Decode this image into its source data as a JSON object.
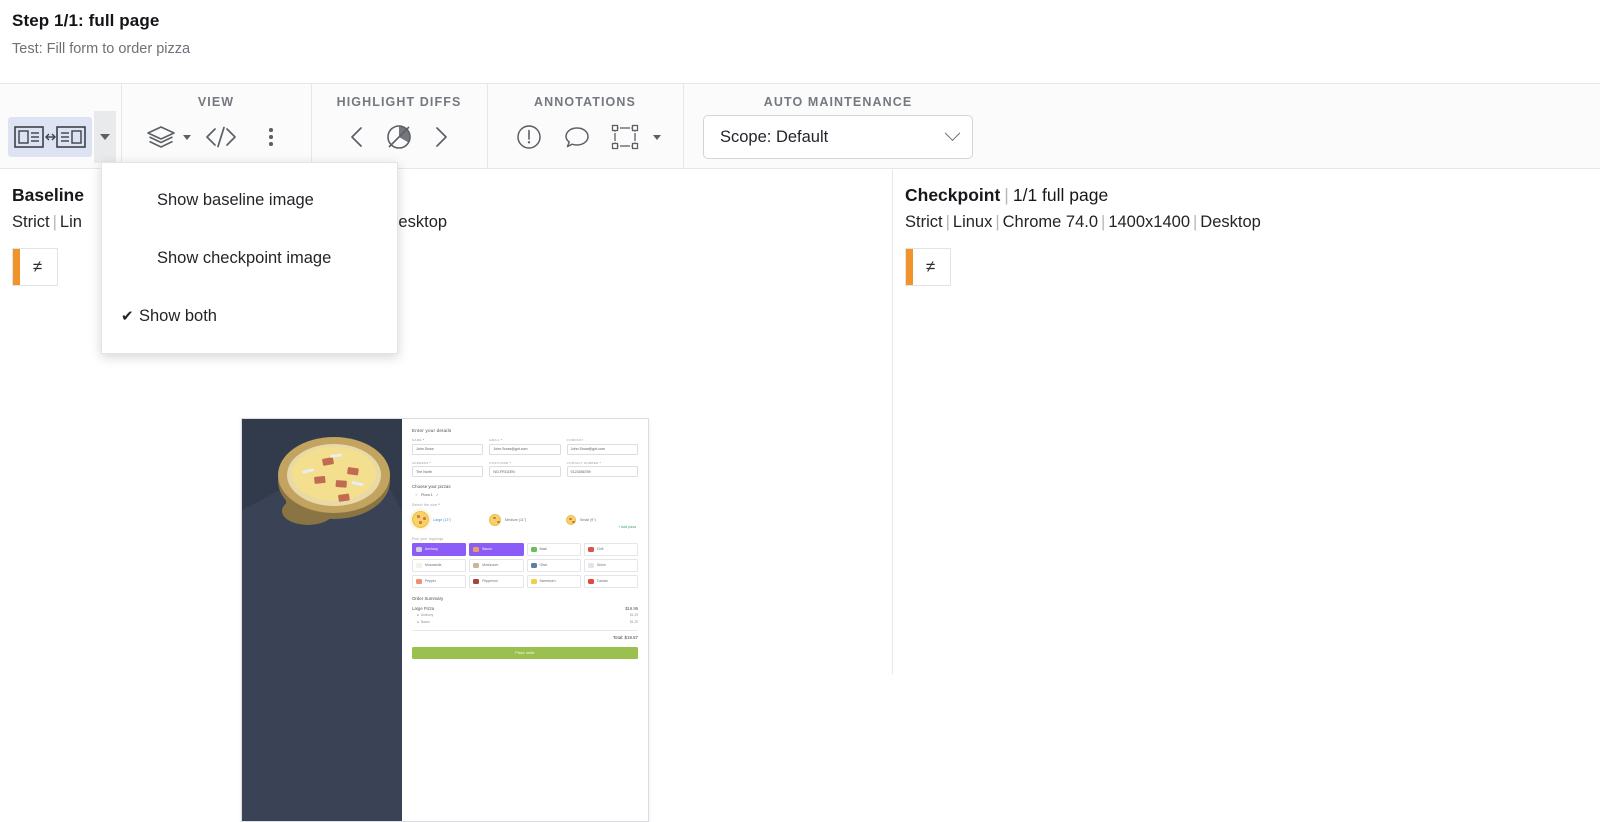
{
  "header": {
    "step_title": "Step 1/1: full page",
    "test_name": "Test: Fill form to order pizza"
  },
  "toolbar": {
    "groups": {
      "view_label": "VIEW",
      "highlight_label": "HIGHLIGHT DIFFS",
      "annotations_label": "ANNOTATIONS",
      "auto_maintenance_label": "AUTO MAINTENANCE"
    },
    "scope_select": "Scope: Default",
    "icons": {
      "layout_toggle": "side-by-side-layout-icon",
      "layers": "layers-icon",
      "code": "code-icon",
      "more": "more-vertical-icon",
      "prev_diff": "chevron-left-icon",
      "diff_target": "diff-circle-icon",
      "next_diff": "chevron-right-icon",
      "issue": "exclamation-circle-icon",
      "comment": "comment-bubble-icon",
      "region": "region-select-icon"
    }
  },
  "menu": {
    "items": [
      {
        "label": "Show baseline image",
        "checked": false
      },
      {
        "label": "Show checkpoint image",
        "checked": false
      },
      {
        "label": "Show both",
        "checked": true
      }
    ],
    "check_glyph": "✔"
  },
  "panels": {
    "baseline": {
      "title": "Baseline",
      "subtitle": "",
      "meta": [
        "Strict",
        "Lin",
        "Desktop"
      ],
      "meta_occluded": true,
      "diff_badge": "≠"
    },
    "checkpoint": {
      "title": "Checkpoint",
      "subtitle": "1/1 full page",
      "meta": [
        "Strict",
        "Linux",
        "Chrome 74.0",
        "1400x1400",
        "Desktop"
      ],
      "diff_badge": "≠"
    }
  },
  "screenshot": {
    "form_heading": "Enter your details",
    "fields_row1": [
      {
        "label": "NAME",
        "required": true,
        "value": "John Snow"
      },
      {
        "label": "EMAIL",
        "required": true,
        "value": "John.Snow@got.com"
      },
      {
        "label": "COMPANY",
        "required": false,
        "value": "John.Snow@got.com"
      }
    ],
    "fields_row2": [
      {
        "label": "ADDRESS",
        "required": true,
        "value": "The North"
      },
      {
        "label": "POSTCODE",
        "required": true,
        "value": "NO-FROZEN"
      },
      {
        "label": "CONTACT NUMBER",
        "required": true,
        "value": "0123456789"
      }
    ],
    "choose_heading": "Choose your pizzas",
    "add_pizza": "+ Add pizza",
    "pizza_tab": "Pizza 1",
    "size_heading": "Select the size",
    "sizes": [
      {
        "label": "Large (13\")",
        "selected": true
      },
      {
        "label": "Medium (11\")",
        "selected": false
      },
      {
        "label": "Small (9\")",
        "selected": false
      }
    ],
    "toppings_heading": "Pick your toppings",
    "toppings": [
      {
        "label": "Anchovy",
        "selected": true,
        "color": "#cfd3d8"
      },
      {
        "label": "Bacon",
        "selected": true,
        "color": "#e8a05a"
      },
      {
        "label": "Basil",
        "selected": false,
        "color": "#6bbf59"
      },
      {
        "label": "Chili",
        "selected": false,
        "color": "#d9534f"
      },
      {
        "label": "Mozzarella",
        "selected": false,
        "color": "#f3f1e8"
      },
      {
        "label": "Mushroom",
        "selected": false,
        "color": "#c8b79a"
      },
      {
        "label": "Olive",
        "selected": false,
        "color": "#5b7fa6"
      },
      {
        "label": "Onion",
        "selected": false,
        "color": "#e6e2ea"
      },
      {
        "label": "Pepper",
        "selected": false,
        "color": "#ef8f6e"
      },
      {
        "label": "Pepperoni",
        "selected": false,
        "color": "#a8423a"
      },
      {
        "label": "Sweetcorn",
        "selected": false,
        "color": "#f2cf4a"
      },
      {
        "label": "Tomato",
        "selected": false,
        "color": "#e4483c"
      }
    ],
    "baseline_topping_color": "#8b5cf6",
    "checkpoint_topping_color": "#f4699e",
    "summary_heading": "Order Summary",
    "summary_item": "Large Pizza",
    "summary_price": "$16.99",
    "summary_extras": [
      {
        "label": "Anchovy",
        "price": "$1.29"
      },
      {
        "label": "Bacon",
        "price": "$1.29"
      }
    ],
    "total_label": "Total: $19.57",
    "place_order": "Place order",
    "hero_bg": "#323b4c",
    "order_button_color": "#9ac14f"
  }
}
